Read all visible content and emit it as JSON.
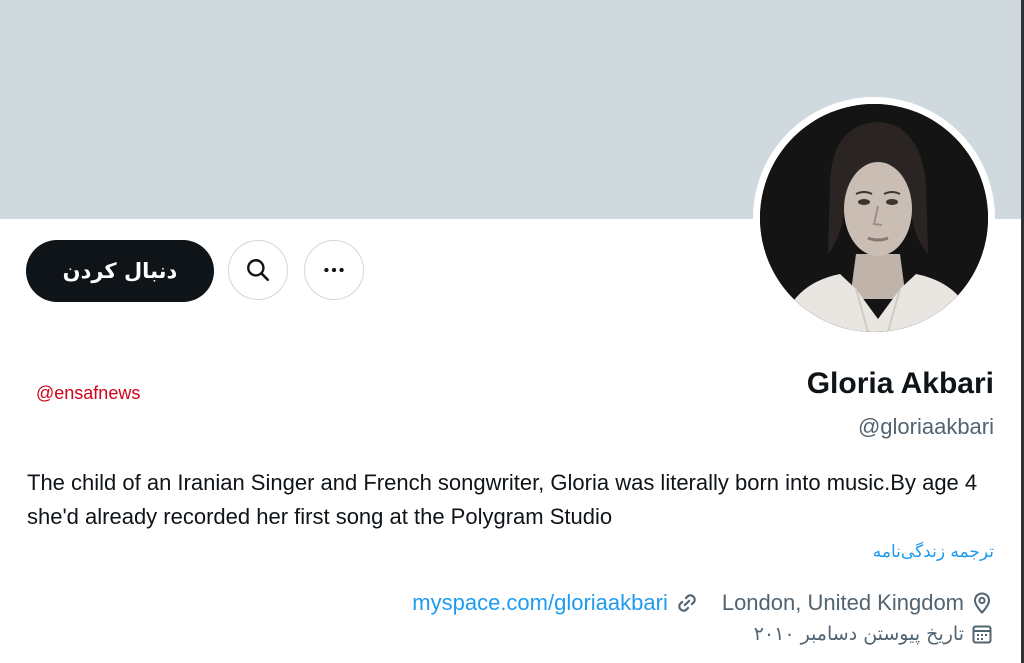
{
  "profile": {
    "name": "Gloria Akbari",
    "handle": "@gloriaakbari",
    "bio": "The child of an Iranian Singer and French songwriter, Gloria was literally born into music.By age 4 she'd already recorded her first song at the Polygram Studio",
    "translate_bio": "ترجمه زندگی‌نامه",
    "location": "London, United Kingdom",
    "website": "myspace.com/gloriaakbari",
    "joined": "تاریخ پیوستن دسامبر ۲۰۱۰"
  },
  "actions": {
    "follow_label": "دنبال کردن",
    "search_icon": "search-icon",
    "more_icon": "more-icon"
  },
  "watermark": "@ensafnews",
  "colors": {
    "banner": "#cfd9de",
    "link": "#1d9bf0",
    "follow_bg": "#0f1419",
    "watermark": "#d0021b",
    "secondary_text": "#536471"
  }
}
